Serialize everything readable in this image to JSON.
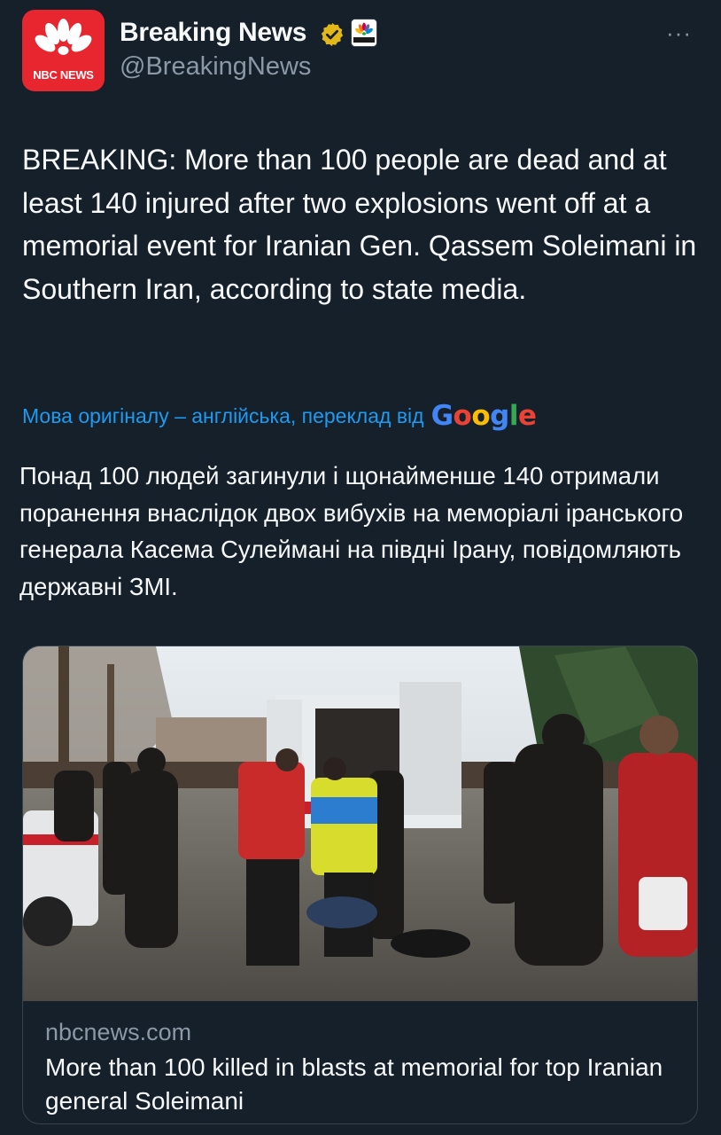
{
  "author": {
    "display_name": "Breaking News",
    "handle": "@BreakingNews",
    "avatar_label": "NBC NEWS",
    "verified_icon": "gold-verified-badge",
    "affiliate_icon": "nbc-peacock-logo"
  },
  "menu": {
    "more_label": "···"
  },
  "tweet": {
    "text": "BREAKING: More than 100 people are dead and at least 140 injured after two explosions went off at a memorial event for Iranian Gen. Qassem Soleimani in Southern Iran, according to state media."
  },
  "translation": {
    "label": "Мова оригіналу – англійська, переклад від",
    "provider": "Google",
    "text": "Понад 100 людей загинули і щонайменше 140 отримали поранення внаслідок двох вибухів на меморіалі іранського генерала Касема Сулеймані на півдні Ірану, повідомляють державні ЗМІ."
  },
  "card": {
    "domain": "nbcnews.com",
    "title": "More than 100 killed in blasts at memorial for top Iranian general Soleimani"
  },
  "colors": {
    "background": "#15202b",
    "text": "#f7f9f9",
    "secondary": "#8b98a5",
    "link": "#1d9bf0",
    "nbc_red": "#e8262f",
    "verified_gold": "#e2b719"
  }
}
